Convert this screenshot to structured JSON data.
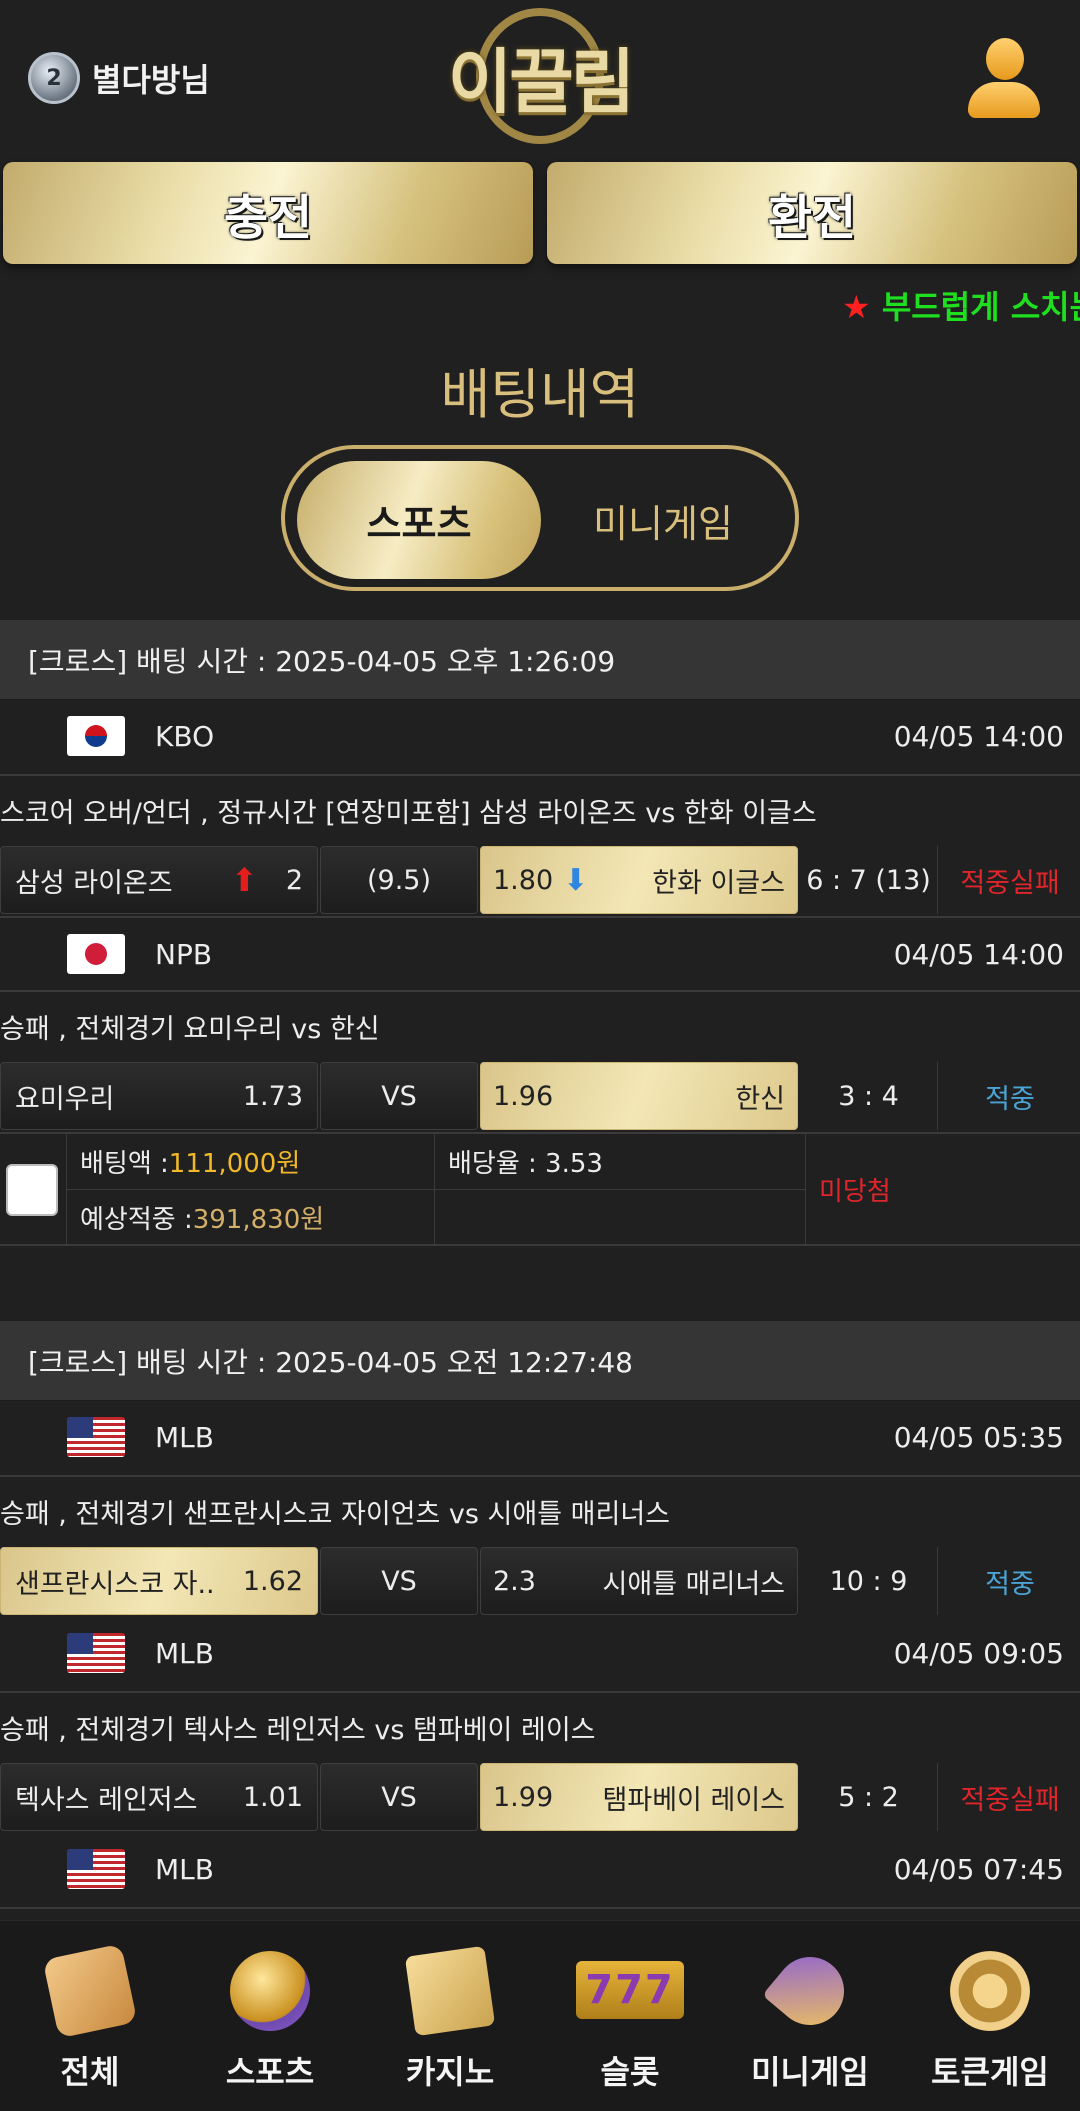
{
  "header": {
    "level": "2",
    "user_name": "별다방님",
    "logo_text": "이끌림"
  },
  "buttons": {
    "deposit": "충전",
    "withdraw": "환전"
  },
  "marquee": {
    "star": "★",
    "text": "부드럽게 스치는"
  },
  "page_title": "배팅내역",
  "tabs": {
    "sports": "스포츠",
    "minigame": "미니게임"
  },
  "groups": [
    {
      "header": "[크로스] 배팅 시간 : 2025-04-05 오후 1:26:09",
      "games": [
        {
          "flag": "kr",
          "league": "KBO",
          "time": "04/05 14:00",
          "market": "스코어 오버/언더 , 정규시간 [연장미포함] 삼성 라이온즈  vs  한화 이글스",
          "home": "삼성 라이온즈",
          "home_odds": "2",
          "mid": "(9.5)",
          "away_odds": "1.80",
          "away": "한화 이글스",
          "score": "6 : 7 (13)",
          "result": "적중실패"
        },
        {
          "flag": "jp",
          "league": "NPB",
          "time": "04/05 14:00",
          "market": "승패 , 전체경기 요미우리  vs  한신",
          "home": "요미우리",
          "home_odds": "1.73",
          "mid": "VS",
          "away_odds": "1.96",
          "away": "한신",
          "score": "3 : 4",
          "result": "적중"
        }
      ],
      "summary": {
        "bet_amount_label": "배팅액 : ",
        "bet_amount": "111,000원",
        "odds_label": "배당율 : 3.53",
        "expected_label": "예상적중 : ",
        "expected": "391,830원",
        "status": "미당첨"
      }
    },
    {
      "header": "[크로스] 배팅 시간 : 2025-04-05 오전 12:27:48",
      "games": [
        {
          "flag": "us",
          "league": "MLB",
          "time": "04/05 05:35",
          "market": "승패 , 전체경기 샌프란시스코 자이언츠  vs  시애틀 매리너스",
          "home": "샌프란시스코 자..",
          "home_odds": "1.62",
          "mid": "VS",
          "away_odds": "2.3",
          "away": "시애틀 매리너스",
          "score": "10 : 9",
          "result": "적중"
        },
        {
          "flag": "us",
          "league": "MLB",
          "time": "04/05 09:05",
          "market": "승패 , 전체경기 텍사스 레인저스  vs  탬파베이 레이스",
          "home": "텍사스 레인저스",
          "home_odds": "1.01",
          "mid": "VS",
          "away_odds": "1.99",
          "away": "탬파베이 레이스",
          "score": "5 : 2",
          "result": "적중실패"
        },
        {
          "flag": "us",
          "league": "MLB",
          "time": "04/05 07:45"
        }
      ]
    }
  ],
  "bottom_nav": [
    {
      "label": "전체",
      "icon": "dice-icon"
    },
    {
      "label": "스포츠",
      "icon": "soccer-ball-icon"
    },
    {
      "label": "카지노",
      "icon": "cards-icon"
    },
    {
      "label": "슬롯",
      "icon": "slot-777-icon",
      "glyph": "777"
    },
    {
      "label": "미니게임",
      "icon": "rocket-icon"
    },
    {
      "label": "토큰게임",
      "icon": "roulette-icon"
    }
  ],
  "colors": {
    "gold": "#d9bf7e",
    "fail_red": "#e0252b",
    "win_blue": "#4aa4d6",
    "marquee_green": "#1ee01e"
  }
}
